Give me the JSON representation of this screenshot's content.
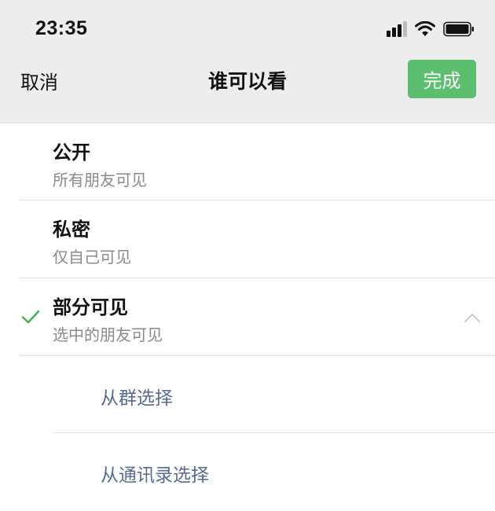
{
  "status_bar": {
    "time": "23:35",
    "icons": [
      "signal-icon",
      "wifi-icon",
      "battery-icon"
    ]
  },
  "nav": {
    "cancel_label": "取消",
    "title": "谁可以看",
    "done_label": "完成"
  },
  "options": [
    {
      "title": "公开",
      "subtitle": "所有朋友可见",
      "selected": false
    },
    {
      "title": "私密",
      "subtitle": "仅自己可见",
      "selected": false
    },
    {
      "title": "部分可见",
      "subtitle": "选中的朋友可见",
      "selected": true,
      "expanded": true
    }
  ],
  "sub_options": [
    {
      "label": "从群选择"
    },
    {
      "label": "从通讯录选择"
    }
  ],
  "colors": {
    "accent_green": "#5cbf6f",
    "check_green": "#3cb24a",
    "link_blue": "#576b95",
    "header_bg": "#ededed"
  }
}
